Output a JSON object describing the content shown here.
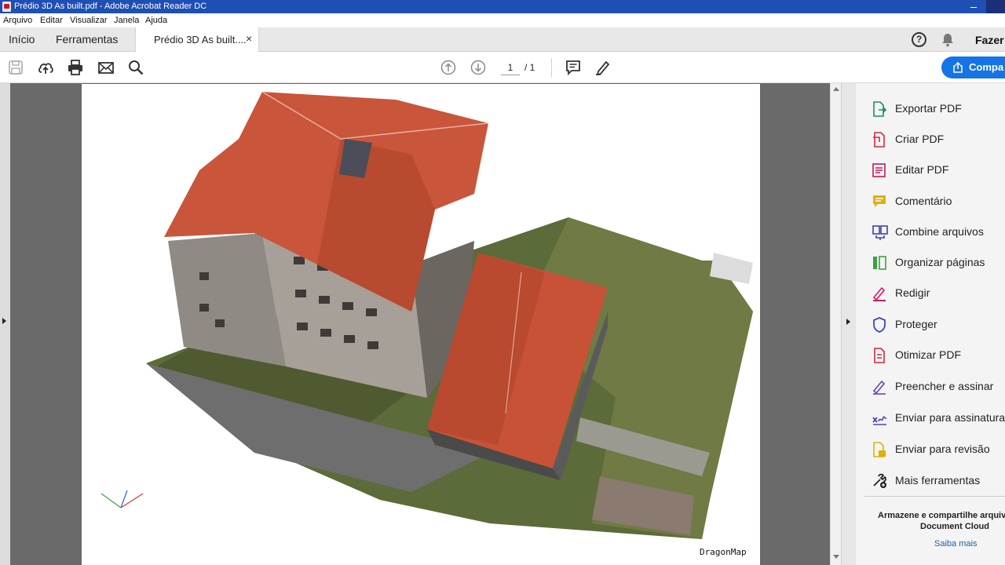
{
  "window": {
    "title": "Prédio 3D As built.pdf - Adobe Acrobat Reader DC"
  },
  "menu": [
    "Arquivo",
    "Editar",
    "Visualizar",
    "Janela",
    "Ajuda"
  ],
  "tabs": {
    "home": "Início",
    "tools": "Ferramentas",
    "document": "Prédio 3D As built....",
    "close": "×"
  },
  "header": {
    "help": "?",
    "signin": "Fazer"
  },
  "toolbar": {
    "page_current": "1",
    "page_total": "/ 1",
    "share": "Compa"
  },
  "document": {
    "watermark": "DragonMap"
  },
  "tools": [
    {
      "label": "Exportar PDF",
      "icon": "export-pdf-icon",
      "color": "#1f8a70"
    },
    {
      "label": "Criar PDF",
      "icon": "create-pdf-icon",
      "color": "#d7263d"
    },
    {
      "label": "Editar PDF",
      "icon": "edit-pdf-icon",
      "color": "#c2185b"
    },
    {
      "label": "Comentário",
      "icon": "comment-icon",
      "color": "#e2b007"
    },
    {
      "label": "Combine arquivos",
      "icon": "combine-files-icon",
      "color": "#3a3fb8"
    },
    {
      "label": "Organizar páginas",
      "icon": "organize-pages-icon",
      "color": "#3ca13c"
    },
    {
      "label": "Redigir",
      "icon": "redact-icon",
      "color": "#d81b60"
    },
    {
      "label": "Proteger",
      "icon": "protect-icon",
      "color": "#3b46c4"
    },
    {
      "label": "Otimizar PDF",
      "icon": "optimize-pdf-icon",
      "color": "#d7263d"
    },
    {
      "label": "Preencher e assinar",
      "icon": "fill-sign-icon",
      "color": "#6a3fc4"
    },
    {
      "label": "Enviar para assinatura",
      "icon": "send-signature-icon",
      "color": "#5b3fc4"
    },
    {
      "label": "Enviar para revisão",
      "icon": "send-review-icon",
      "color": "#e2b007"
    },
    {
      "label": "Mais ferramentas",
      "icon": "more-tools-icon",
      "color": "#222222"
    }
  ],
  "promo": {
    "line1": "Armazene e compartilhe arquiv",
    "line2": "Document Cloud",
    "link": "Saiba mais"
  }
}
